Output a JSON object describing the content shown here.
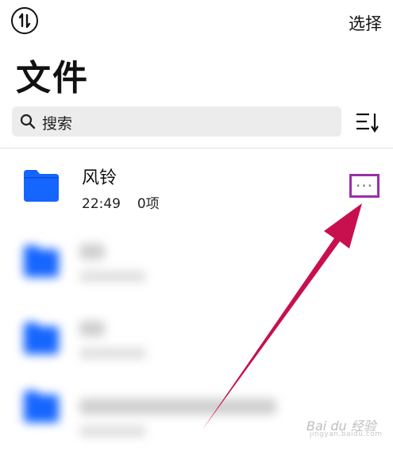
{
  "header": {
    "select_label": "选择",
    "title": "文件"
  },
  "search": {
    "placeholder": "搜索"
  },
  "files": [
    {
      "name": "风铃",
      "time": "22:49",
      "count": "0项",
      "icon": "folder-icon",
      "blurred": false
    },
    {
      "name": "",
      "time": "",
      "count": "",
      "icon": "folder-icon",
      "blurred": true
    },
    {
      "name": "",
      "time": "",
      "count": "",
      "icon": "folder-icon",
      "blurred": true
    },
    {
      "name": "",
      "time": "",
      "count": "",
      "icon": "folder-icon",
      "blurred": true
    }
  ],
  "actions": {
    "more_label": "···"
  },
  "colors": {
    "folder": "#1565ff",
    "highlight_box": "#9a2fa8",
    "arrow": "#c8104f",
    "search_bg": "#ececec"
  },
  "watermark": {
    "brand": "Bai du 经验",
    "sub": "jingyan.baidu.com"
  }
}
